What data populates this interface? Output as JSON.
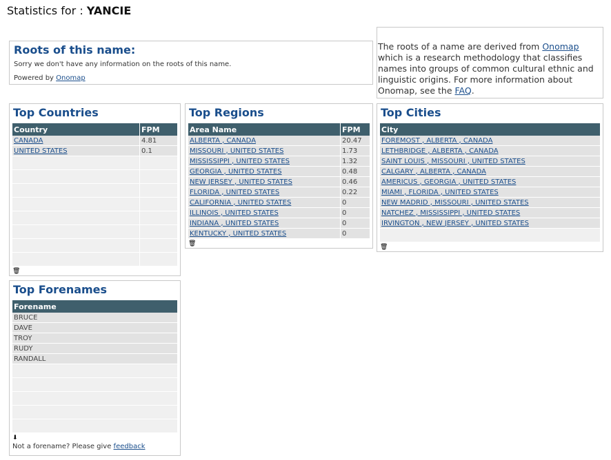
{
  "page": {
    "title_prefix": "Statistics for : ",
    "surname": "YANCIE"
  },
  "roots": {
    "heading": "Roots of this name:",
    "message": "Sorry we don't have any information on the roots of this name.",
    "powered_by": "Powered by ",
    "powered_link": "Onomap"
  },
  "info": {
    "text1": "The roots of a name are derived from ",
    "link1": "Onomap",
    "text2": " which is a research methodology that classifies names into groups of common cultural ethnic and linguistic origins. For more information about Onomap, see the ",
    "link2": "FAQ",
    "text3": "."
  },
  "countries": {
    "heading": "Top Countries",
    "columns": [
      "Country",
      "FPM"
    ],
    "rows": [
      {
        "name": "CANADA",
        "fpm": "4.81"
      },
      {
        "name": "UNITED STATES",
        "fpm": "0.1"
      }
    ]
  },
  "regions": {
    "heading": "Top Regions",
    "columns": [
      "Area Name",
      "FPM"
    ],
    "rows": [
      {
        "name": "ALBERTA , CANADA",
        "fpm": "20.47"
      },
      {
        "name": "MISSOURI , UNITED STATES",
        "fpm": "1.73"
      },
      {
        "name": "MISSISSIPPI , UNITED STATES",
        "fpm": "1.32"
      },
      {
        "name": "GEORGIA , UNITED STATES",
        "fpm": "0.48"
      },
      {
        "name": "NEW JERSEY , UNITED STATES",
        "fpm": "0.46"
      },
      {
        "name": "FLORIDA , UNITED STATES",
        "fpm": "0.22"
      },
      {
        "name": "CALIFORNIA , UNITED STATES",
        "fpm": "0"
      },
      {
        "name": "ILLINOIS , UNITED STATES",
        "fpm": "0"
      },
      {
        "name": "INDIANA , UNITED STATES",
        "fpm": "0"
      },
      {
        "name": "KENTUCKY , UNITED STATES",
        "fpm": "0"
      }
    ]
  },
  "cities": {
    "heading": "Top Cities",
    "columns": [
      "City"
    ],
    "rows": [
      "FOREMOST , ALBERTA , CANADA",
      "LETHBRIDGE , ALBERTA , CANADA",
      "SAINT LOUIS , MISSOURI , UNITED STATES",
      "CALGARY , ALBERTA , CANADA",
      "AMERICUS , GEORGIA , UNITED STATES",
      "MIAMI , FLORIDA , UNITED STATES",
      "NEW MADRID , MISSOURI , UNITED STATES",
      "NATCHEZ , MISSISSIPPI , UNITED STATES",
      "IRVINGTON , NEW JERSEY , UNITED STATES"
    ]
  },
  "forenames": {
    "heading": "Top Forenames",
    "columns": [
      "Forename"
    ],
    "rows": [
      "BRUCE",
      "DAVE",
      "TROY",
      "RUDY",
      "RANDALL"
    ],
    "note": "Not a forename? Please give ",
    "note_link": "feedback"
  },
  "icons": {
    "trash": "trash-icon",
    "download": "download-icon"
  }
}
